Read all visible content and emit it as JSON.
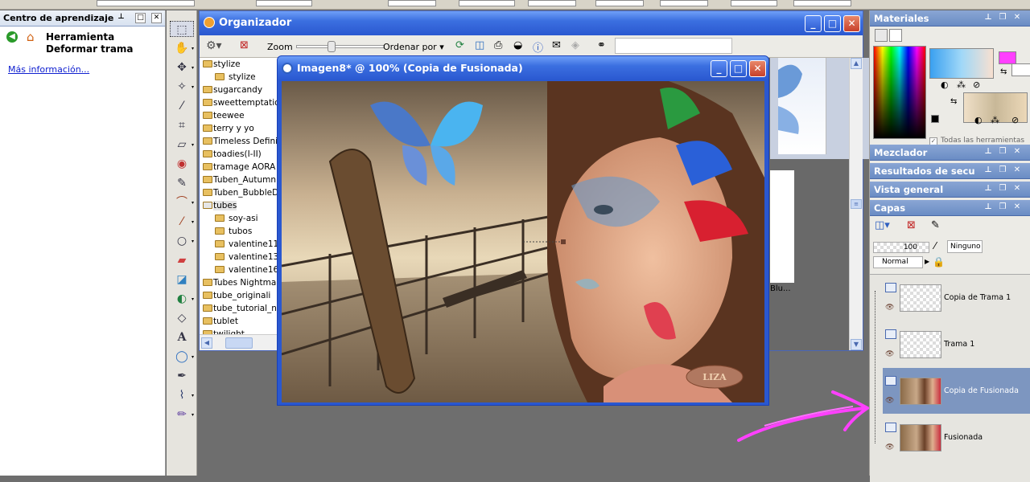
{
  "learning_center": {
    "panel_title": "Centro de aprendizaje",
    "tool_title": "Herramienta Deformar trama",
    "more_info": "Más información..."
  },
  "organizer": {
    "title": "Organizador",
    "zoom_label": "Zoom",
    "sort_label": "Ordenar por",
    "folders": [
      {
        "name": "stylize",
        "level": 0,
        "selected": false
      },
      {
        "name": "stylize",
        "level": 1,
        "selected": false
      },
      {
        "name": "sugarcandy",
        "level": 0,
        "selected": false
      },
      {
        "name": "sweettemptation",
        "level": 0,
        "selected": false
      },
      {
        "name": "teewee",
        "level": 0,
        "selected": false
      },
      {
        "name": "terry y yo",
        "level": 0,
        "selected": false
      },
      {
        "name": "Timeless Definition",
        "level": 0,
        "selected": false
      },
      {
        "name": "toadies(I-II)",
        "level": 0,
        "selected": false
      },
      {
        "name": "tramage AORA",
        "level": 0,
        "selected": false
      },
      {
        "name": "Tuben_AutumnM",
        "level": 0,
        "selected": false
      },
      {
        "name": "Tuben_BubbleDr",
        "level": 0,
        "selected": false
      },
      {
        "name": "tubes",
        "level": 0,
        "selected": true
      },
      {
        "name": "soy-asi",
        "level": 1,
        "selected": false
      },
      {
        "name": "tubos",
        "level": 1,
        "selected": false
      },
      {
        "name": "valentine11",
        "level": 1,
        "selected": false
      },
      {
        "name": "valentine13",
        "level": 1,
        "selected": false
      },
      {
        "name": "valentine16",
        "level": 1,
        "selected": false
      },
      {
        "name": "Tubes Nightmare",
        "level": 0,
        "selected": false
      },
      {
        "name": "tube_originali",
        "level": 0,
        "selected": false
      },
      {
        "name": "tube_tutorial_na",
        "level": 0,
        "selected": false
      },
      {
        "name": "tublet",
        "level": 0,
        "selected": false
      },
      {
        "name": "twilight",
        "level": 0,
        "selected": false
      }
    ],
    "thumb_caption": "Blu..."
  },
  "image_window": {
    "title": "Imagen8* @ 100% (Copia de Fusionada)",
    "watermark": "LIZA"
  },
  "right_panels": {
    "materials_title": "Materiales",
    "all_tools_label": "Todas las herramientas",
    "mixer_title": "Mezclador",
    "sequence_title": "Resultados de secuencia",
    "overview_title": "Vista general",
    "layers_title": "Capas",
    "opacity_value": "100",
    "mask_label": "Ninguno",
    "blend_mode": "Normal",
    "layers": [
      {
        "name": "Copia de Trama 1",
        "thumb": "checker",
        "selected": false
      },
      {
        "name": "Trama 1",
        "thumb": "checker",
        "selected": false
      },
      {
        "name": "Copia de Fusionada",
        "thumb": "photo",
        "selected": true
      },
      {
        "name": "Fusionada",
        "thumb": "photo",
        "selected": false
      }
    ]
  },
  "colors": {
    "accent_pink": "#ff40ff",
    "xp_blue": "#2a58d0",
    "selected_layer": "#7d96c0"
  }
}
